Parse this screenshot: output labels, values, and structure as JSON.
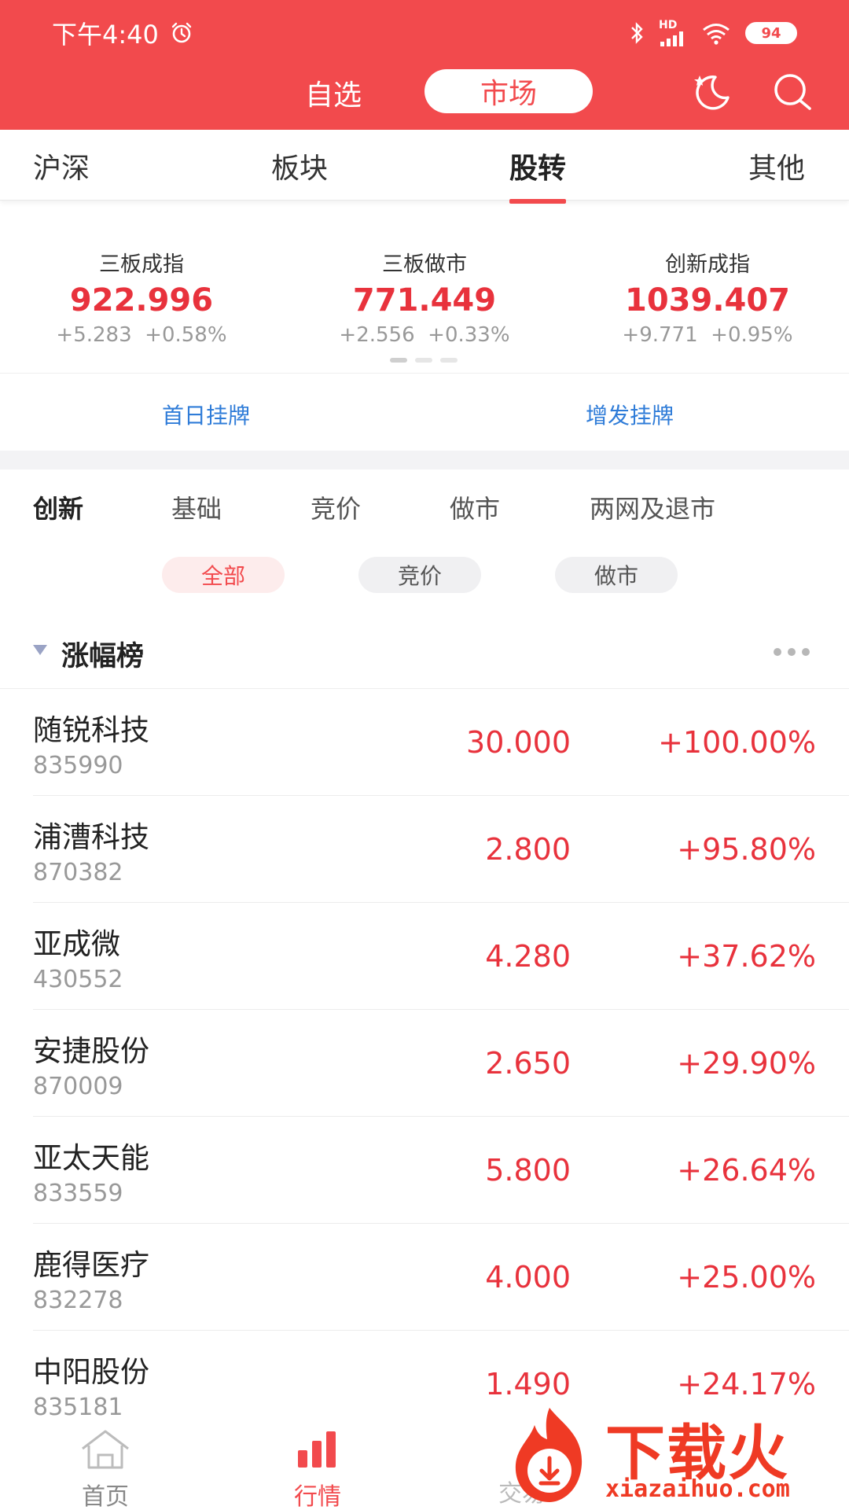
{
  "status_bar": {
    "time": "下午4:40",
    "network": "HD",
    "battery": "94"
  },
  "top_nav": {
    "tabs": [
      "自选",
      "市场"
    ],
    "active": "市场"
  },
  "sub_tabs": {
    "items": [
      "沪深",
      "板块",
      "股转",
      "其他"
    ],
    "active": "股转"
  },
  "indexes": [
    {
      "name": "三板成指",
      "value": "922.996",
      "change": "+5.283",
      "percent": "+0.58%"
    },
    {
      "name": "三板做市",
      "value": "771.449",
      "change": "+2.556",
      "percent": "+0.33%"
    },
    {
      "name": "创新成指",
      "value": "1039.407",
      "change": "+9.771",
      "percent": "+0.95%"
    }
  ],
  "listing_links": [
    "首日挂牌",
    "增发挂牌"
  ],
  "categories": {
    "items": [
      "创新",
      "基础",
      "竞价",
      "做市",
      "两网及退市"
    ],
    "active": "创新"
  },
  "filters": {
    "items": [
      "全部",
      "竞价",
      "做市"
    ],
    "active": "全部"
  },
  "ranking": {
    "title": "涨幅榜",
    "rows": [
      {
        "name": "随锐科技",
        "code": "835990",
        "price": "30.000",
        "percent": "+100.00%"
      },
      {
        "name": "浦漕科技",
        "code": "870382",
        "price": "2.800",
        "percent": "+95.80%"
      },
      {
        "name": "亚成微",
        "code": "430552",
        "price": "4.280",
        "percent": "+37.62%"
      },
      {
        "name": "安捷股份",
        "code": "870009",
        "price": "2.650",
        "percent": "+29.90%"
      },
      {
        "name": "亚太天能",
        "code": "833559",
        "price": "5.800",
        "percent": "+26.64%"
      },
      {
        "name": "鹿得医疗",
        "code": "832278",
        "price": "4.000",
        "percent": "+25.00%"
      },
      {
        "name": "中阳股份",
        "code": "835181",
        "price": "1.490",
        "percent": "+24.17%"
      }
    ]
  },
  "bottom_nav": {
    "items": [
      "首页",
      "行情",
      "交易"
    ],
    "active": "行情"
  },
  "watermark": {
    "brand": "下载火",
    "url": "xiazaihuo.com"
  },
  "colors": {
    "brand_red": "#f24a4d",
    "up_red": "#e8323c",
    "link_blue": "#2f7cd8"
  }
}
